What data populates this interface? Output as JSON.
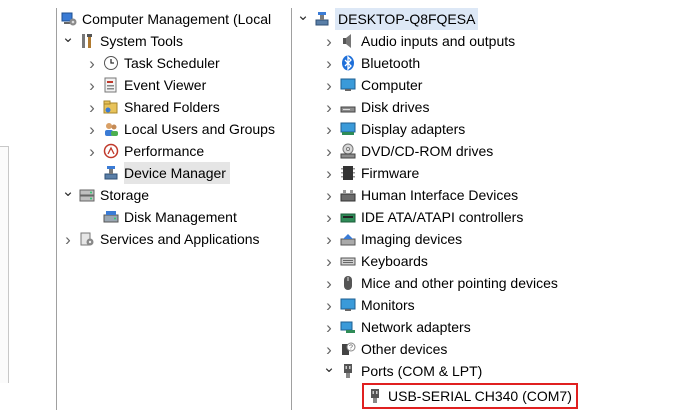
{
  "left_tree": {
    "root": {
      "label": "Computer Management (Local",
      "icon": "computer-management-icon"
    },
    "system_tools": {
      "label": "System Tools",
      "icon": "tools-icon",
      "expanded": true
    },
    "items": [
      {
        "label": "Task Scheduler",
        "icon": "clock-icon"
      },
      {
        "label": "Event Viewer",
        "icon": "event-log-icon"
      },
      {
        "label": "Shared Folders",
        "icon": "shared-folder-icon"
      },
      {
        "label": "Local Users and Groups",
        "icon": "users-icon"
      },
      {
        "label": "Performance",
        "icon": "no-sign-icon"
      },
      {
        "label": "Device Manager",
        "icon": "device-manager-icon",
        "selected": true
      }
    ],
    "storage": {
      "label": "Storage",
      "icon": "storage-icon",
      "expanded": true
    },
    "disk_management": {
      "label": "Disk Management",
      "icon": "disk-management-icon"
    },
    "services": {
      "label": "Services and Applications",
      "icon": "services-icon"
    }
  },
  "right_tree": {
    "root": {
      "label": "DESKTOP-Q8FQESA",
      "icon": "computer-root-icon"
    },
    "categories": [
      {
        "label": "Audio inputs and outputs",
        "icon": "speaker-icon"
      },
      {
        "label": "Bluetooth",
        "icon": "bluetooth-icon"
      },
      {
        "label": "Computer",
        "icon": "monitor-icon"
      },
      {
        "label": "Disk drives",
        "icon": "disk-drive-icon"
      },
      {
        "label": "Display adapters",
        "icon": "display-adapter-icon"
      },
      {
        "label": "DVD/CD-ROM drives",
        "icon": "dvd-drive-icon"
      },
      {
        "label": "Firmware",
        "icon": "chip-icon"
      },
      {
        "label": "Human Interface Devices",
        "icon": "hid-icon"
      },
      {
        "label": "IDE ATA/ATAPI controllers",
        "icon": "ide-controller-icon"
      },
      {
        "label": "Imaging devices",
        "icon": "camera-icon"
      },
      {
        "label": "Keyboards",
        "icon": "keyboard-icon"
      },
      {
        "label": "Mice and other pointing devices",
        "icon": "mouse-icon"
      },
      {
        "label": "Monitors",
        "icon": "monitor-icon"
      },
      {
        "label": "Network adapters",
        "icon": "network-icon"
      },
      {
        "label": "Other devices",
        "icon": "unknown-device-icon"
      },
      {
        "label": "Ports (COM & LPT)",
        "icon": "port-icon",
        "expanded": true
      }
    ],
    "port_child": {
      "label": "USB-SERIAL CH340 (COM7)",
      "icon": "port-connector-icon",
      "highlight_color": "#e02020"
    }
  }
}
